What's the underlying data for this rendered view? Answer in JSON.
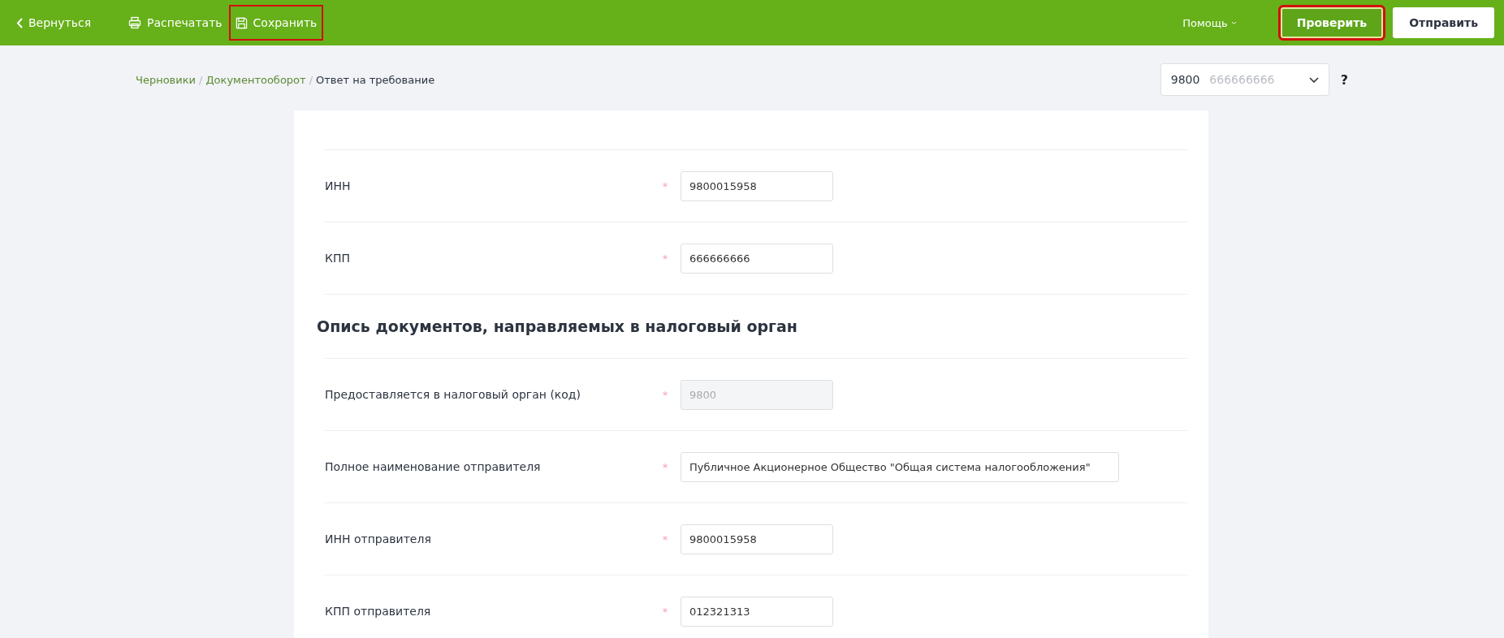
{
  "toolbar": {
    "back": {
      "label": "Вернуться"
    },
    "actions": [
      {
        "kind": "print",
        "label": "Распечатать",
        "highlighted": false
      },
      {
        "kind": "save",
        "label": "Сохранить",
        "highlighted": true
      }
    ],
    "help": {
      "label": "Помощь"
    },
    "buttons": [
      {
        "kind": "primary",
        "label": "Проверить",
        "highlighted": true
      },
      {
        "kind": "secondary",
        "label": "Отправить",
        "highlighted": false
      }
    ]
  },
  "breadcrumbs": {
    "separator": "/",
    "items": [
      {
        "label": "Черновики",
        "link": true
      },
      {
        "label": "Документооборот",
        "link": true
      },
      {
        "label": "Ответ на требование",
        "link": false
      }
    ]
  },
  "org_select": {
    "code": "9800",
    "kpp": "666666666",
    "help": "?"
  },
  "form": [
    {
      "kind": "field",
      "label": "ИНН",
      "required_mark": "*",
      "value": "9800015958",
      "disabled": false,
      "wide": false
    },
    {
      "kind": "field",
      "label": "КПП",
      "required_mark": "*",
      "value": "666666666",
      "disabled": false,
      "wide": false
    },
    {
      "kind": "heading",
      "label": "Опись документов, направляемых в налоговый орган"
    },
    {
      "kind": "field",
      "label": "Предоставляется в налоговый орган (код)",
      "required_mark": "*",
      "value": "9800",
      "disabled": true,
      "wide": false
    },
    {
      "kind": "field",
      "label": "Полное наименование отправителя",
      "required_mark": "*",
      "value": "Публичное Акционерное Общество \"Общая система налогообложения\"",
      "disabled": false,
      "wide": true
    },
    {
      "kind": "field",
      "label": "ИНН отправителя",
      "required_mark": "*",
      "value": "9800015958",
      "disabled": false,
      "wide": false
    },
    {
      "kind": "field",
      "label": "КПП отправителя",
      "required_mark": "*",
      "value": "012321313",
      "disabled": false,
      "wide": false
    }
  ]
}
